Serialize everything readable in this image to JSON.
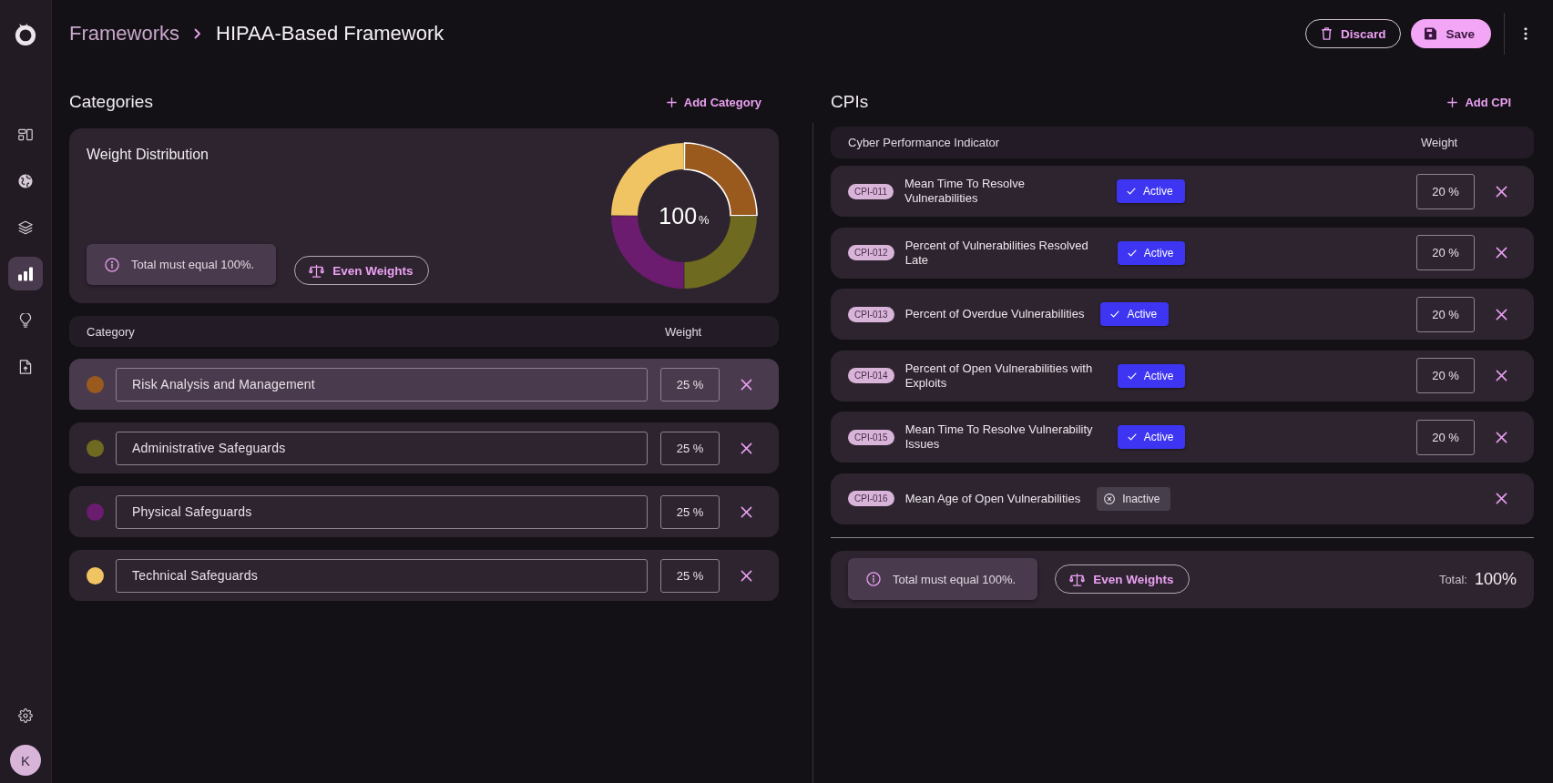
{
  "sidebar": {
    "items": [
      {
        "selected": false
      },
      {
        "selected": false
      },
      {
        "selected": false
      },
      {
        "selected": true
      },
      {
        "selected": false
      },
      {
        "selected": false
      }
    ],
    "avatar": "K"
  },
  "header": {
    "breadcrumbs": [
      "Frameworks",
      "HIPAA-Based Framework"
    ],
    "buttons": [
      {
        "kind": "discard",
        "label": "Discard"
      },
      {
        "kind": "save",
        "label": "Save"
      }
    ]
  },
  "categories": {
    "title": "Categories",
    "add_label": "Add Category",
    "distribution": {
      "title": "Weight Distribution",
      "total": "100",
      "total_unit": "%",
      "info": "Total must equal 100%.",
      "even_button": "Even Weights"
    },
    "columns": [
      "Category",
      "Weight"
    ],
    "rows": [
      {
        "name": "Risk Analysis and Management",
        "weight": "25 %",
        "color": "#9a5a1e",
        "selected": true
      },
      {
        "name": "Administrative Safeguards",
        "weight": "25 %",
        "color": "#6e6b20",
        "selected": false
      },
      {
        "name": "Physical Safeguards",
        "weight": "25 %",
        "color": "#6b1c6f",
        "selected": false
      },
      {
        "name": "Technical Safeguards",
        "weight": "25 %",
        "color": "#f0c463",
        "selected": false
      }
    ]
  },
  "cpis": {
    "title": "CPIs",
    "add_label": "Add CPI",
    "columns": [
      "Cyber Performance Indicator",
      "Weight"
    ],
    "rows": [
      {
        "code": "CPI-011",
        "name": "Mean Time To Resolve Vulnerabilities",
        "status": "Active",
        "active": true,
        "weight": "20 %"
      },
      {
        "code": "CPI-012",
        "name": "Percent of Vulnerabilities Resolved Late",
        "status": "Active",
        "active": true,
        "weight": "20 %"
      },
      {
        "code": "CPI-013",
        "name": "Percent of Overdue Vulnerabilities",
        "status": "Active",
        "active": true,
        "weight": "20 %"
      },
      {
        "code": "CPI-014",
        "name": "Percent of Open Vulnerabilities with Exploits",
        "status": "Active",
        "active": true,
        "weight": "20 %"
      },
      {
        "code": "CPI-015",
        "name": "Mean Time To Resolve Vulnerability Issues",
        "status": "Active",
        "active": true,
        "weight": "20 %"
      },
      {
        "code": "CPI-016",
        "name": "Mean Age of Open Vulnerabilities",
        "status": "Inactive",
        "active": false
      }
    ],
    "footer": {
      "info": "Total must equal 100%.",
      "even_button": "Even Weights",
      "total_label": "Total:",
      "total_value": "100%"
    }
  }
}
